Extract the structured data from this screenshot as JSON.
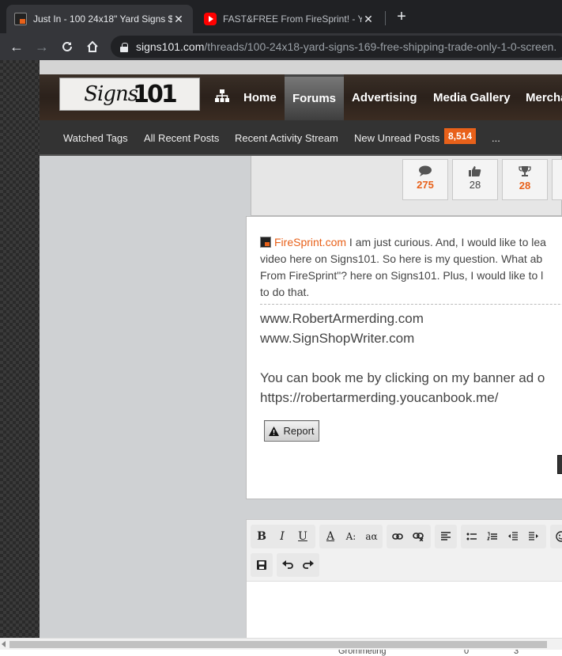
{
  "browser": {
    "tabs": [
      {
        "title": "Just In - 100 24x18\" Yard Signs $",
        "active": true
      },
      {
        "title": "FAST&FREE From FireSprint! - Yo",
        "active": false
      }
    ],
    "new_tab_symbol": "+",
    "url_host": "signs101.com",
    "url_path": "/threads/100-24x18-yard-signs-169-free-shipping-trade-only-1-0-screen."
  },
  "site": {
    "logo_text_script": "Signs",
    "logo_text_num": "101",
    "main_nav": [
      "Home",
      "Forums",
      "Advertising",
      "Media Gallery",
      "Mercha"
    ],
    "active_nav": "Forums",
    "sub_nav": {
      "watched_tags": "Watched Tags",
      "all_recent_posts": "All Recent Posts",
      "recent_activity_stream": "Recent Activity Stream",
      "new_unread_posts": "New Unread Posts",
      "unread_count": "8,514",
      "more": "..."
    }
  },
  "stats": [
    {
      "icon": "comments-icon",
      "value": "275",
      "highlight": true
    },
    {
      "icon": "thumbs-up-icon",
      "value": "28",
      "highlight": false
    },
    {
      "icon": "trophy-icon",
      "value": "28",
      "highlight": true
    }
  ],
  "post": {
    "mention": "FireSprint.com",
    "line1_rest": " I am just curious. And, I would like to lea",
    "line2": "video here on Signs101. So here is my question. What ab",
    "line3": "From FireSprint\"? here on Signs101. Plus, I would like to l",
    "line4": "to do that.",
    "signature": {
      "site1": "www.RobertArmerding.com",
      "site2": "www.SignShopWriter.com",
      "booking": "You can book me by clicking on my banner ad o",
      "booking_url": "https://robertarmerding.youcanbook.me/"
    },
    "report_label": "Report"
  },
  "editor": {
    "toolbar_row1": [
      "B",
      "I",
      "U",
      "A",
      "A:",
      "aα",
      "link",
      "unlink",
      "align",
      "bullets",
      "numbers",
      "outdent",
      "indent",
      "smile"
    ],
    "toolbar_row2": [
      "save",
      "undo",
      "redo"
    ]
  },
  "footer_peek": {
    "label": "Grommeting",
    "col1": "0",
    "col2": "3"
  },
  "colors": {
    "accent": "#e8611a",
    "header_bg": "#2b211b",
    "subnav_bg": "#333333",
    "chrome_bg": "#202124"
  }
}
